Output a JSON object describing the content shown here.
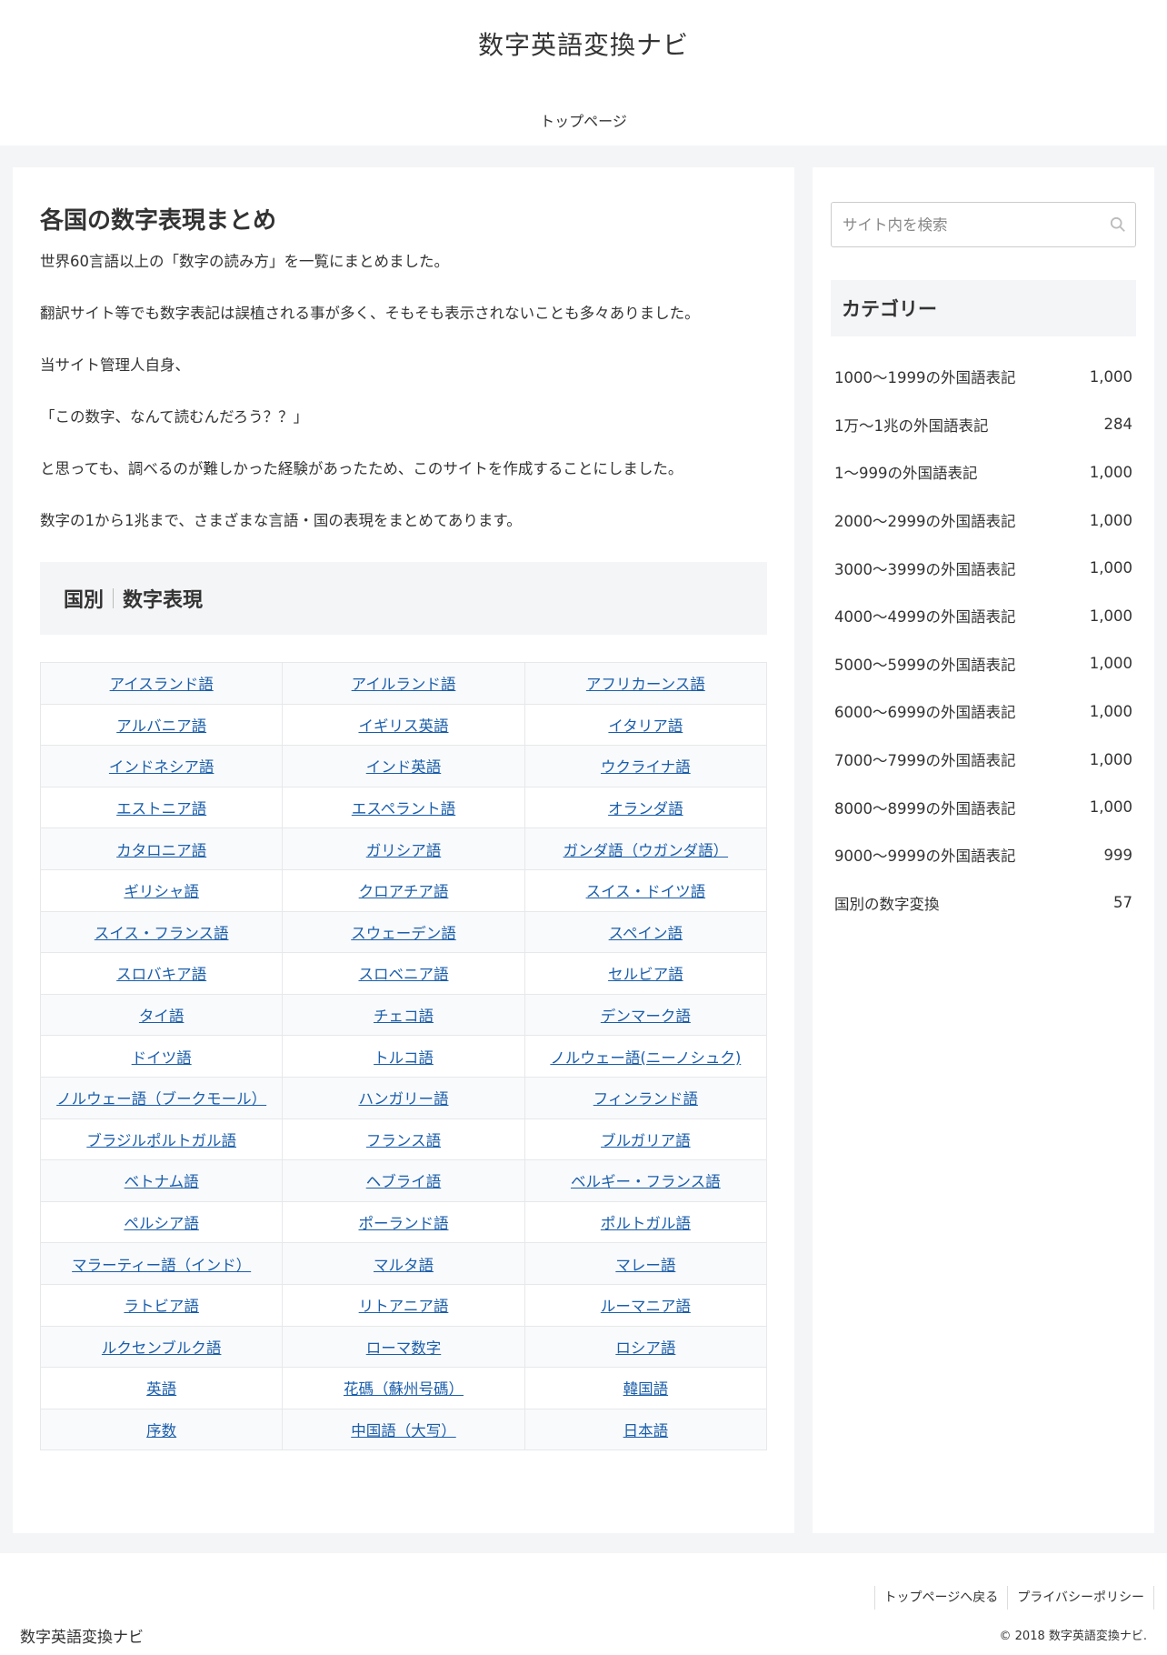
{
  "header": {
    "site_title": "数字英語変換ナビ",
    "nav_items": [
      "トップページ"
    ]
  },
  "main": {
    "title": "各国の数字表現まとめ",
    "paragraphs": [
      "世界60言語以上の「数字の読み方」を一覧にまとめました。",
      "翻訳サイト等でも数字表記は誤植される事が多く、そもそも表示されないことも多々ありました。",
      "当サイト管理人自身、",
      "「この数字、なんて読むんだろう？？」",
      "と思っても、調べるのが難しかった経験があったため、このサイトを作成することにしました。",
      "数字の1から1兆まで、さまざまな言語・国の表現をまとめてあります。"
    ],
    "section_heading_left": "国別",
    "section_heading_right": "数字表現",
    "languages": [
      [
        "アイスランド語",
        "アイルランド語",
        "アフリカーンス語"
      ],
      [
        "アルバニア語",
        "イギリス英語",
        "イタリア語"
      ],
      [
        "インドネシア語",
        "インド英語",
        "ウクライナ語"
      ],
      [
        "エストニア語",
        "エスペラント語",
        "オランダ語"
      ],
      [
        "カタロニア語",
        "ガリシア語",
        "ガンダ語（ウガンダ語）"
      ],
      [
        "ギリシャ語",
        "クロアチア語",
        "スイス・ドイツ語"
      ],
      [
        "スイス・フランス語",
        "スウェーデン語",
        "スペイン語"
      ],
      [
        "スロバキア語",
        "スロベニア語",
        "セルビア語"
      ],
      [
        "タイ語",
        "チェコ語",
        "デンマーク語"
      ],
      [
        "ドイツ語",
        "トルコ語",
        "ノルウェー語(ニーノシュク)"
      ],
      [
        "ノルウェー語（ブークモール）",
        "ハンガリー語",
        "フィンランド語"
      ],
      [
        "ブラジルポルトガル語",
        "フランス語",
        "ブルガリア語"
      ],
      [
        "ベトナム語",
        "ヘブライ語",
        "ベルギー・フランス語"
      ],
      [
        "ペルシア語",
        "ポーランド語",
        "ポルトガル語"
      ],
      [
        "マラーティー語（インド）",
        "マルタ語",
        "マレー語"
      ],
      [
        "ラトビア語",
        "リトアニア語",
        "ルーマニア語"
      ],
      [
        "ルクセンブルク語",
        "ローマ数字",
        "ロシア語"
      ],
      [
        "英語",
        "花碼（蘇州号碼）",
        "韓国語"
      ],
      [
        "序数",
        "中国語（大写）",
        "日本語"
      ]
    ]
  },
  "sidebar": {
    "search_placeholder": "サイト内を検索",
    "category_title": "カテゴリー",
    "categories": [
      {
        "label": "1000〜1999の外国語表記",
        "count": "1,000"
      },
      {
        "label": "1万〜1兆の外国語表記",
        "count": "284"
      },
      {
        "label": "1〜999の外国語表記",
        "count": "1,000"
      },
      {
        "label": "2000〜2999の外国語表記",
        "count": "1,000"
      },
      {
        "label": "3000〜3999の外国語表記",
        "count": "1,000"
      },
      {
        "label": "4000〜4999の外国語表記",
        "count": "1,000"
      },
      {
        "label": "5000〜5999の外国語表記",
        "count": "1,000"
      },
      {
        "label": "6000〜6999の外国語表記",
        "count": "1,000"
      },
      {
        "label": "7000〜7999の外国語表記",
        "count": "1,000"
      },
      {
        "label": "8000〜8999の外国語表記",
        "count": "1,000"
      },
      {
        "label": "9000〜9999の外国語表記",
        "count": "999"
      },
      {
        "label": "国別の数字変換",
        "count": "57"
      }
    ]
  },
  "footer": {
    "links": [
      "トップページへ戻る",
      "プライバシーポリシー"
    ],
    "logo": "数字英語変換ナビ",
    "copyright": "© 2018 数字英語変換ナビ."
  },
  "colors": {
    "link": "#1a5eab",
    "background": "#f4f5f7",
    "text": "#333333"
  }
}
